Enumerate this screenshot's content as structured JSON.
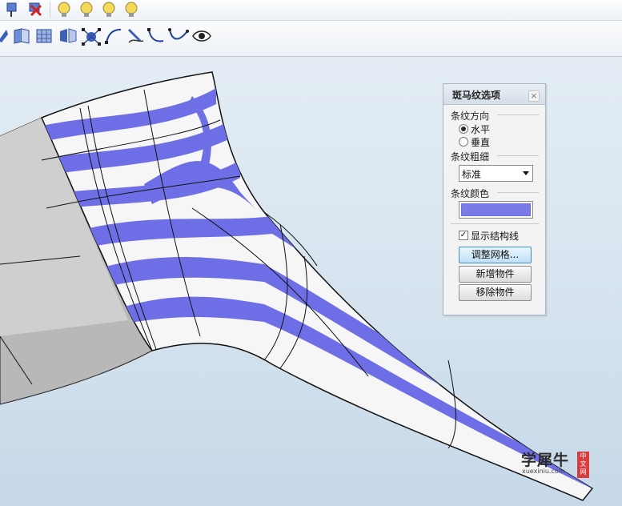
{
  "toolbar_top": {
    "icons": [
      "pin-icon",
      "delete-icon",
      "lightbulb-icon",
      "lightbulb-icon",
      "lightbulb-icon",
      "lightbulb-icon"
    ]
  },
  "toolbar_main": {
    "icons": [
      "surface-icon",
      "face-icon",
      "mesh-icon",
      "flip-icon",
      "control-points-icon",
      "curve-icon",
      "pen-icon",
      "curve-edit-icon",
      "node-curve-icon",
      "eye-icon"
    ]
  },
  "panel": {
    "title": "斑马纹选项",
    "close": "×",
    "direction_label": "条纹方向",
    "direction_options": [
      "水平",
      "垂直"
    ],
    "direction_selected": "水平",
    "thickness_label": "条纹粗细",
    "thickness_value": "标准",
    "color_label": "条纹颜色",
    "stripe_color": "#7b7be8",
    "show_lines_label": "显示结构线",
    "show_lines_checked": true,
    "check_mark": "✓",
    "buttons": [
      "调整网格...",
      "新增物件",
      "移除物件"
    ]
  },
  "watermark": {
    "cn": "学犀牛",
    "en": "xuexiniu.com",
    "tag": "中文网"
  },
  "colors": {
    "stripe": "#6f6fe3",
    "surface": "#f7f7f7"
  }
}
